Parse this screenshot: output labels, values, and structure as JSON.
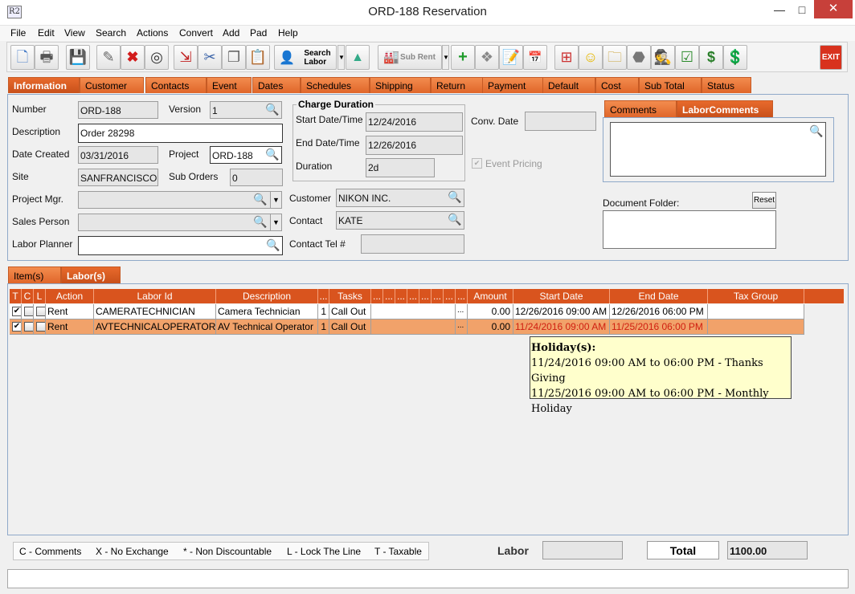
{
  "window": {
    "title": "ORD-188 Reservation",
    "icon_text": "R2",
    "minimize": "—",
    "maximize": "□",
    "close": "✕"
  },
  "menu": [
    "File",
    "Edit",
    "View",
    "Search",
    "Actions",
    "Convert",
    "Add",
    "Pad",
    "Help"
  ],
  "toolbar": {
    "search_labor": "Search\nLabor",
    "sub_rent": "Sub Rent",
    "exit": "EXIT"
  },
  "tabs": [
    "Information",
    "Customer",
    "Contacts",
    "Event",
    "Dates",
    "Schedules",
    "Shipping",
    "Return",
    "Payment",
    "Default",
    "Cost",
    "Sub Total",
    "Status"
  ],
  "form": {
    "number_label": "Number",
    "number": "ORD-188",
    "version_label": "Version",
    "version": "1",
    "description_label": "Description",
    "description": "Order 28298",
    "date_created_label": "Date Created",
    "date_created": "03/31/2016",
    "project_label": "Project",
    "project": "ORD-188",
    "site_label": "Site",
    "site": "SANFRANCISCO",
    "sub_orders_label": "Sub Orders",
    "sub_orders": "0",
    "project_mgr_label": "Project Mgr.",
    "project_mgr": "",
    "sales_person_label": "Sales Person",
    "sales_person": "",
    "labor_planner_label": "Labor Planner",
    "labor_planner": "",
    "charge_duration_title": "Charge Duration",
    "start_label": "Start Date/Time",
    "start": "12/24/2016",
    "end_label": "End Date/Time",
    "end": "12/26/2016",
    "duration_label": "Duration",
    "duration": "2d",
    "conv_date_label": "Conv. Date",
    "conv_date": "",
    "event_pricing_label": "Event Pricing",
    "customer_label": "Customer",
    "customer": "NIKON INC.",
    "contact_label": "Contact",
    "contact": "KATE",
    "contact_tel_label": "Contact Tel #",
    "contact_tel": ""
  },
  "comments": {
    "tabs": [
      "Comments",
      "LaborComments"
    ],
    "document_folder_label": "Document Folder:",
    "reset_label": "Reset"
  },
  "grid_tabs": [
    "Item(s)",
    "Labor(s)"
  ],
  "grid": {
    "headers": [
      "T",
      "C",
      "L",
      "Action",
      "Labor Id",
      "Description",
      "...",
      "Tasks",
      "...",
      "...",
      "...",
      "...",
      "...",
      "...",
      "...",
      "...",
      "Amount",
      "Start Date",
      "End Date",
      "Tax Group"
    ],
    "rows": [
      {
        "t": "✔",
        "action": "Rent",
        "labor_id": "CAMERATECHNICIAN",
        "description": "Camera Technician",
        "qty": "1",
        "tasks": "Call Out",
        "dots": "...",
        "amount": "0.00",
        "start": "12/26/2016 09:00 AM",
        "end": "12/26/2016 06:00 PM",
        "tax_group": ""
      },
      {
        "t": "✔",
        "action": "Rent",
        "labor_id": "AVTECHNICALOPERATOR",
        "description": "AV Technical Operator",
        "qty": "1",
        "tasks": "Call Out",
        "dots": "...",
        "amount": "0.00",
        "start": "11/24/2016 09:00 AM",
        "end": "11/25/2016 06:00 PM",
        "tax_group": ""
      }
    ]
  },
  "tooltip": {
    "title": "Holiday(s):",
    "lines": [
      "11/24/2016 09:00 AM to 06:00 PM - Thanks Giving",
      "11/25/2016 09:00 AM to 06:00 PM - Monthly Holiday"
    ]
  },
  "legend": [
    "C - Comments",
    "X - No Exchange",
    "* - Non Discountable",
    "L - Lock The Line",
    "T - Taxable"
  ],
  "totals": {
    "labor_label": "Labor",
    "labor_value": "",
    "total_label": "Total",
    "total_value": "1100.00"
  },
  "colors": {
    "tab_orange": "#e0662a",
    "header_orange": "#d9541e",
    "selected_row": "#f1a26a",
    "holiday_red": "#d01f10"
  }
}
